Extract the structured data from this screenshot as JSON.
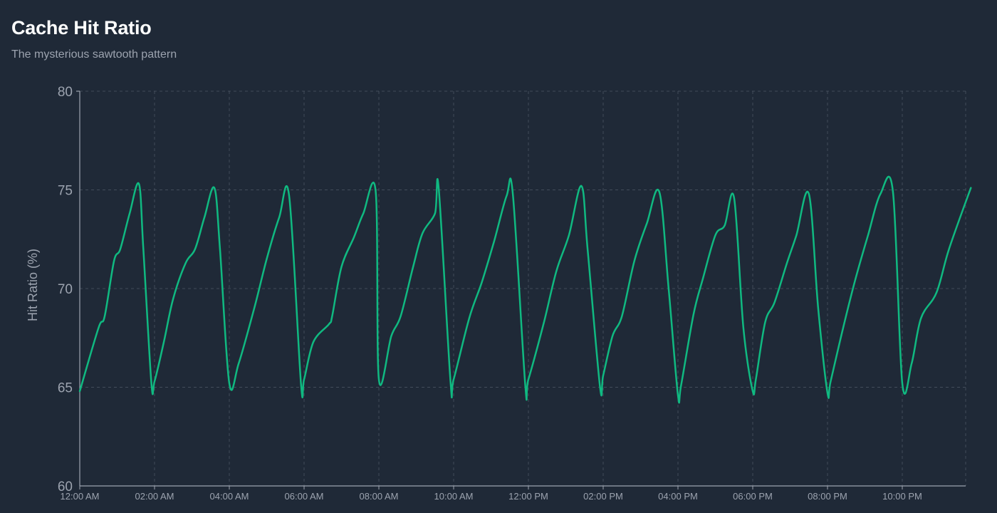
{
  "header": {
    "title": "Cache Hit Ratio",
    "subtitle": "The mysterious sawtooth pattern"
  },
  "colors": {
    "background": "#1f2937",
    "line": "#10b981",
    "grid": "#4b5563",
    "axis": "#9ca3af",
    "text": "#9ca3af"
  },
  "chart_data": {
    "type": "line",
    "title": "Cache Hit Ratio",
    "subtitle": "The mysterious sawtooth pattern",
    "xlabel": "",
    "ylabel": "Hit Ratio (%)",
    "ylim": [
      60,
      80
    ],
    "yticks": [
      60,
      65,
      70,
      75,
      80
    ],
    "x_hours_range": [
      0,
      23.85
    ],
    "xtick_labels": [
      "12:00 AM",
      "02:00 AM",
      "04:00 AM",
      "06:00 AM",
      "08:00 AM",
      "10:00 AM",
      "12:00 PM",
      "02:00 PM",
      "04:00 PM",
      "06:00 PM",
      "08:00 PM",
      "10:00 PM"
    ],
    "grid": true,
    "legend": "none",
    "series": [
      {
        "x": [
          "00:00",
          "00:30",
          "00:40",
          "00:55",
          "01:05",
          "01:20",
          "01:35",
          "01:42",
          "01:55",
          "02:00",
          "02:15",
          "02:30",
          "02:50",
          "03:05",
          "03:20",
          "03:36",
          "03:45",
          "04:00",
          "04:15",
          "04:40",
          "05:00",
          "05:20",
          "05:36",
          "05:55",
          "06:00",
          "06:15",
          "06:40",
          "06:45",
          "07:00",
          "07:20",
          "07:35",
          "07:55",
          "08:00",
          "08:20",
          "08:35",
          "08:55",
          "09:10",
          "09:30",
          "09:36",
          "09:55",
          "10:00",
          "10:25",
          "10:45",
          "11:05",
          "11:25",
          "11:35",
          "11:55",
          "12:00",
          "12:25",
          "12:45",
          "13:05",
          "13:25",
          "13:35",
          "13:55",
          "14:00",
          "14:15",
          "14:30",
          "14:50",
          "15:10",
          "15:30",
          "15:45",
          "16:00",
          "16:05",
          "16:25",
          "16:40",
          "17:00",
          "17:15",
          "17:30",
          "17:45",
          "18:00",
          "18:05",
          "18:20",
          "18:35",
          "18:55",
          "19:10",
          "19:30",
          "19:45",
          "20:00",
          "20:05",
          "20:25",
          "20:45",
          "21:05",
          "21:25",
          "21:45",
          "22:00",
          "22:15",
          "22:30",
          "22:55",
          "23:15",
          "23:50"
        ],
        "values": [
          64.8,
          68.0,
          68.6,
          71.4,
          72.0,
          73.8,
          75.3,
          72.0,
          65.2,
          65.3,
          67.3,
          69.5,
          71.3,
          72.0,
          73.6,
          75.1,
          72.0,
          65.2,
          66.2,
          69.0,
          71.5,
          73.6,
          74.7,
          65.2,
          65.4,
          67.3,
          68.2,
          68.6,
          71.1,
          72.6,
          73.8,
          74.9,
          65.4,
          67.6,
          68.6,
          71.1,
          72.8,
          73.8,
          75.1,
          65.3,
          65.4,
          68.5,
          70.3,
          72.4,
          74.7,
          74.8,
          65.1,
          65.4,
          68.3,
          70.9,
          72.7,
          75.2,
          72.0,
          65.0,
          65.6,
          67.6,
          68.6,
          71.4,
          73.3,
          74.9,
          70.0,
          64.6,
          65.1,
          68.7,
          70.5,
          72.7,
          73.2,
          74.6,
          68.0,
          64.8,
          65.4,
          68.3,
          69.3,
          71.3,
          72.7,
          74.8,
          69.0,
          64.7,
          65.3,
          68.0,
          70.5,
          72.7,
          74.8,
          74.9,
          65.2,
          66.2,
          68.5,
          69.8,
          72.0,
          75.1
        ]
      }
    ]
  }
}
